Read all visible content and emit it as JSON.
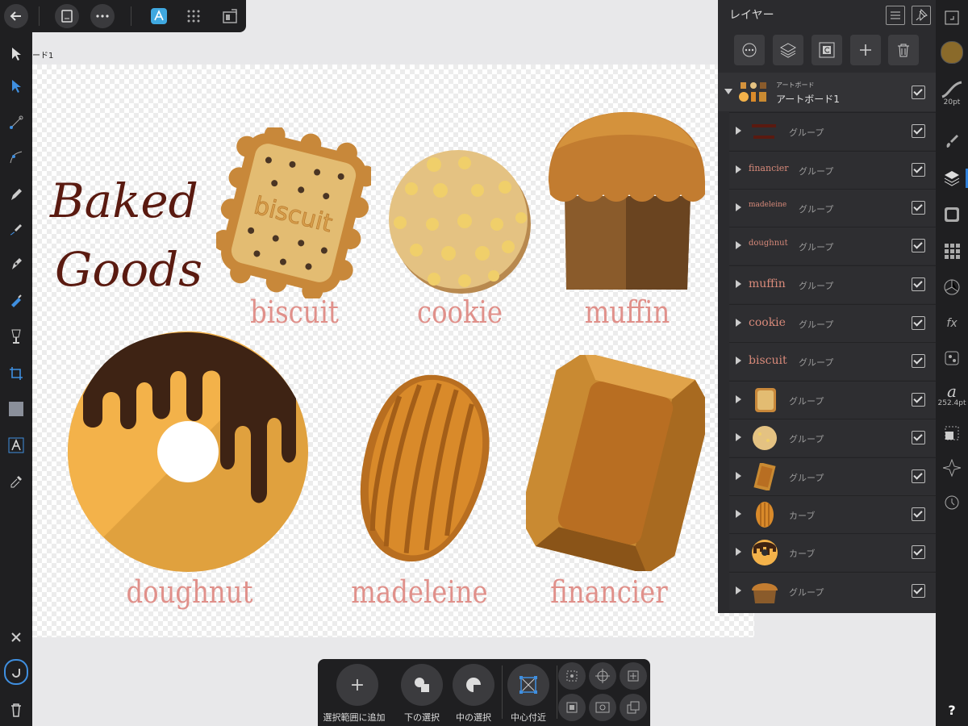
{
  "artboard_label": "ード1",
  "canvas": {
    "title_line1": "Baked",
    "title_line2": "Goods",
    "biscuit_embossed": "biscuit",
    "labels": [
      "biscuit",
      "cookie",
      "muffin",
      "doughnut",
      "madeleine",
      "financier"
    ]
  },
  "layers_panel": {
    "title": "レイヤー",
    "artboard": {
      "type": "アートボード",
      "name": "アートボード1"
    },
    "rows": [
      {
        "name": "",
        "kind": "グループ",
        "thumb": "baked-goods-text"
      },
      {
        "name": "financier",
        "kind": "グループ",
        "thumb": ""
      },
      {
        "name": "madeleine",
        "kind": "グループ",
        "thumb": ""
      },
      {
        "name": "doughnut",
        "kind": "グループ",
        "thumb": ""
      },
      {
        "name": "muffin",
        "kind": "グループ",
        "thumb": ""
      },
      {
        "name": "cookie",
        "kind": "グループ",
        "thumb": ""
      },
      {
        "name": "biscuit",
        "kind": "グループ",
        "thumb": ""
      },
      {
        "name": "",
        "kind": "グループ",
        "thumb": "biscuit"
      },
      {
        "name": "",
        "kind": "グループ",
        "thumb": "cookie"
      },
      {
        "name": "",
        "kind": "グループ",
        "thumb": "financier"
      },
      {
        "name": "",
        "kind": "カーブ",
        "thumb": "madeleine"
      },
      {
        "name": "",
        "kind": "カーブ",
        "thumb": "doughnut"
      },
      {
        "name": "",
        "kind": "グループ",
        "thumb": "muffin"
      }
    ]
  },
  "right_strip": {
    "brush_size": "20pt",
    "font_size": "252.4pt",
    "help": "?"
  },
  "bottom_bar": {
    "add_to_selection": "選択範囲に追加",
    "select_below": "下の選択",
    "select_middle": "中の選択",
    "near_center": "中心付近"
  },
  "colors": {
    "label": "#e0908a",
    "panel": "#2b2b2e",
    "toolbar": "#1f1f21",
    "accent": "#2f7fd8"
  }
}
